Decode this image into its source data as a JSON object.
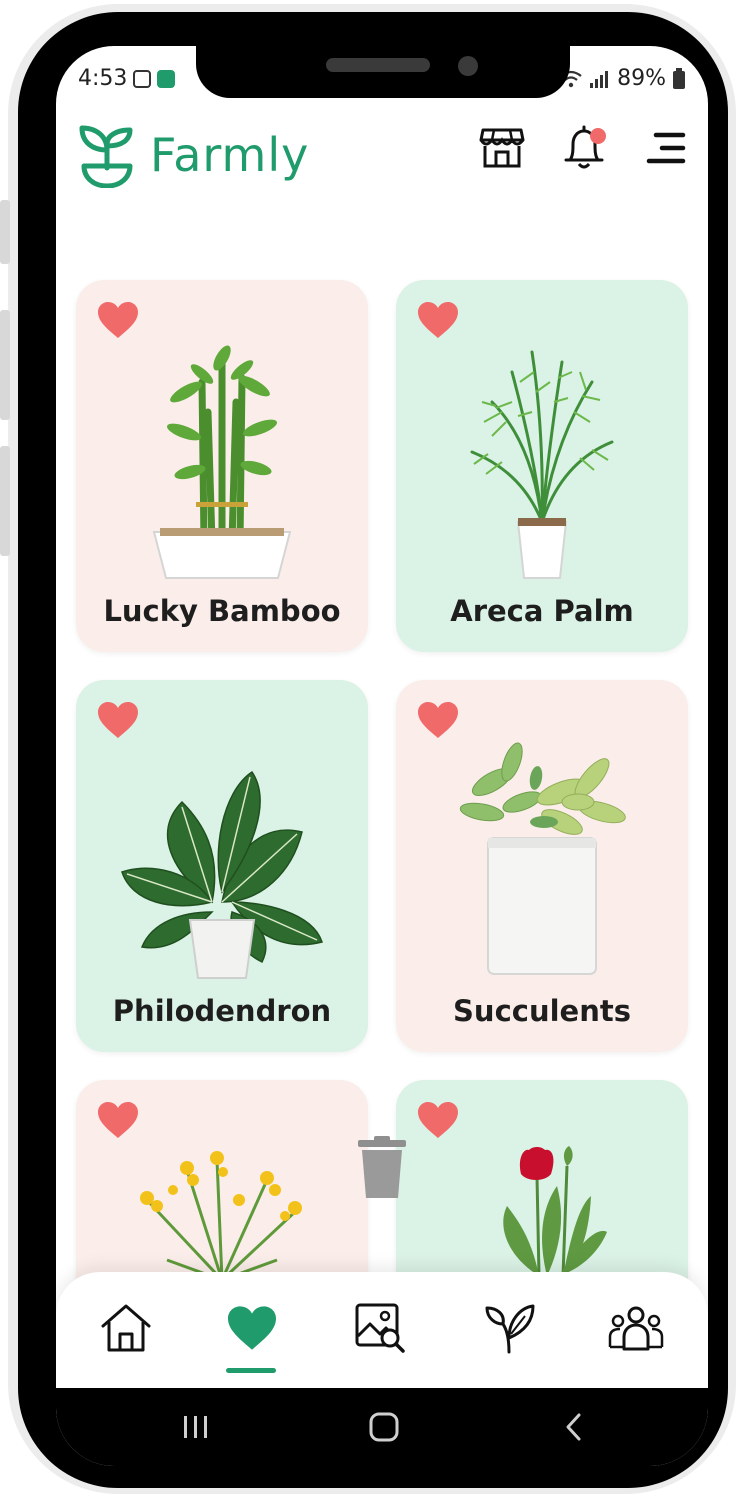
{
  "status_bar": {
    "time": "4:53",
    "battery": "89%"
  },
  "app": {
    "name": "Farmly",
    "brand_color": "#1f9b6c",
    "heart_color": "#f06a6a"
  },
  "header_icons": [
    "store-icon",
    "bell-icon",
    "menu-icon"
  ],
  "favorites": [
    {
      "name": "Lucky Bamboo",
      "bg": "#fbeeea",
      "plant": "lucky-bamboo-image"
    },
    {
      "name": "Areca Palm",
      "bg": "#dbf2e6",
      "plant": "areca-palm-image"
    },
    {
      "name": "Philodendron",
      "bg": "#dbf2e6",
      "plant": "philodendron-image"
    },
    {
      "name": "Succulents",
      "bg": "#fbeeea",
      "plant": "succulents-image"
    },
    {
      "name": "",
      "bg": "#fbeeea",
      "plant": "yellow-flowers-image"
    },
    {
      "name": "",
      "bg": "#dbf2e6",
      "plant": "tulip-image"
    }
  ],
  "bottom_nav": {
    "active": "favorites",
    "items": [
      "home-icon",
      "heart-icon",
      "image-search-icon",
      "sprout-icon",
      "community-icon"
    ]
  }
}
